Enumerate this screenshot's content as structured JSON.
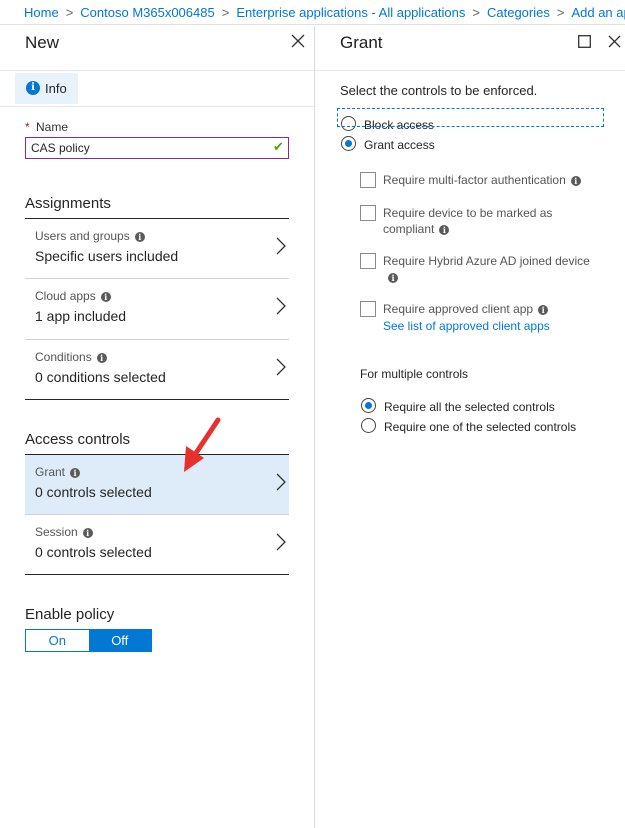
{
  "breadcrumb": [
    "Home",
    "Contoso M365x006485",
    "Enterprise applications - All applications",
    "Categories",
    "Add an ap"
  ],
  "left_blade": {
    "title": "New",
    "info_tab": "Info",
    "name_label": "Name",
    "name_value": "CAS policy",
    "assignments_heading": "Assignments",
    "assignments": [
      {
        "label": "Users and groups",
        "value": "Specific users included"
      },
      {
        "label": "Cloud apps",
        "value": "1 app included"
      },
      {
        "label": "Conditions",
        "value": "0 conditions selected"
      }
    ],
    "access_heading": "Access controls",
    "access": [
      {
        "label": "Grant",
        "value": "0 controls selected",
        "selected": true
      },
      {
        "label": "Session",
        "value": "0 controls selected",
        "selected": false
      }
    ],
    "enable_heading": "Enable policy",
    "toggle": {
      "on": "On",
      "off": "Off",
      "selected": "Off"
    }
  },
  "right_blade": {
    "title": "Grant",
    "instruction": "Select the controls to be enforced.",
    "block_access": "Block access",
    "grant_access": "Grant access",
    "selected_access": "Grant access",
    "checkboxes": [
      {
        "line1": "Require multi-factor authentication",
        "line2": "",
        "checked": false
      },
      {
        "line1": "Require device to be marked as",
        "line2": "compliant",
        "checked": false
      },
      {
        "line1": "Require Hybrid Azure AD joined device",
        "line2": "",
        "checked": false
      },
      {
        "line1": "Require approved client app",
        "line2": "",
        "checked": false
      }
    ],
    "approved_apps_link": "See list of approved client apps",
    "multiple_heading": "For multiple controls",
    "multiple_all": "Require all the selected controls",
    "multiple_one": "Require one of the selected controls",
    "multiple_selected": "Require all the selected controls"
  },
  "colors": {
    "accent": "#0078d4",
    "selected_row": "#deecf9",
    "arrow": "#e8302f",
    "valid_check": "#57a300",
    "name_border": "#8a2b8a"
  }
}
